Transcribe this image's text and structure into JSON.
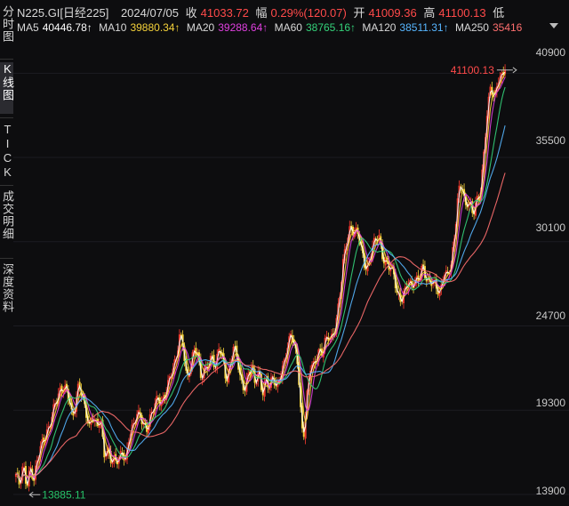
{
  "header": {
    "symbol": "N225.GI[日经225]",
    "date": "2024/07/05",
    "close_label": "收",
    "close_value": "41033.72",
    "change_label": "幅",
    "change_value": "0.29%(120.07)",
    "open_label": "开",
    "open_value": "41009.36",
    "high_label": "高",
    "high_value": "41100.13",
    "low_label": "低"
  },
  "ma_row": [
    {
      "label": "MA5",
      "value": "40446.78↑",
      "color": "#ffffff"
    },
    {
      "label": "MA10",
      "value": "39880.34↑",
      "color": "#f5d23a"
    },
    {
      "label": "MA20",
      "value": "39288.64↑",
      "color": "#e040e0"
    },
    {
      "label": "MA60",
      "value": "38765.16↑",
      "color": "#34d27a"
    },
    {
      "label": "MA120",
      "value": "38511.31↑",
      "color": "#57b6ff"
    },
    {
      "label": "MA250",
      "value": "35416",
      "color": "#ff6f6f"
    }
  ],
  "sidebar": {
    "tab_fenshi": "分时图",
    "tab_k": "K线图",
    "tab_tick": "TICK",
    "tab_deal": "成交明细",
    "tab_depth": "深度资料"
  },
  "colors": {
    "up": "#ff3b30",
    "down": "#f5d23a",
    "red_text": "#ff4a4a",
    "green_text": "#27c469",
    "background": "#0d0d0f"
  },
  "chart_data": {
    "type": "candlestick",
    "y_ticks": [
      "40900",
      "35500",
      "30100",
      "24700",
      "19300",
      "13900"
    ],
    "y_range": [
      13900,
      42400
    ],
    "max_label": "41100.13",
    "min_label": "13885.11",
    "close_path": [
      [
        0,
        15200
      ],
      [
        4,
        14400
      ],
      [
        8,
        15600
      ],
      [
        12,
        14500
      ],
      [
        16,
        15800
      ],
      [
        20,
        14900
      ],
      [
        24,
        16100
      ],
      [
        30,
        17200
      ],
      [
        36,
        18200
      ],
      [
        42,
        19500
      ],
      [
        48,
        20200
      ],
      [
        52,
        20600
      ],
      [
        56,
        20800
      ],
      [
        60,
        20000
      ],
      [
        63,
        18800
      ],
      [
        66,
        19600
      ],
      [
        70,
        20800
      ],
      [
        74,
        20100
      ],
      [
        78,
        19200
      ],
      [
        82,
        18400
      ],
      [
        86,
        19000
      ],
      [
        90,
        18000
      ],
      [
        94,
        18700
      ],
      [
        98,
        16500
      ],
      [
        102,
        16900
      ],
      [
        106,
        16200
      ],
      [
        110,
        16000
      ],
      [
        114,
        15900
      ],
      [
        118,
        16600
      ],
      [
        122,
        16200
      ],
      [
        126,
        17800
      ],
      [
        130,
        18200
      ],
      [
        134,
        18800
      ],
      [
        138,
        18900
      ],
      [
        142,
        18400
      ],
      [
        146,
        18300
      ],
      [
        150,
        19000
      ],
      [
        154,
        19500
      ],
      [
        158,
        19900
      ],
      [
        162,
        19700
      ],
      [
        166,
        20500
      ],
      [
        170,
        21300
      ],
      [
        174,
        21800
      ],
      [
        178,
        22300
      ],
      [
        182,
        24000
      ],
      [
        186,
        23600
      ],
      [
        190,
        21400
      ],
      [
        194,
        22000
      ],
      [
        198,
        23000
      ],
      [
        202,
        22800
      ],
      [
        206,
        21400
      ],
      [
        210,
        22100
      ],
      [
        214,
        22300
      ],
      [
        218,
        22600
      ],
      [
        222,
        21800
      ],
      [
        226,
        23400
      ],
      [
        230,
        22800
      ],
      [
        234,
        21300
      ],
      [
        238,
        22000
      ],
      [
        242,
        23200
      ],
      [
        246,
        22600
      ],
      [
        250,
        21300
      ],
      [
        254,
        20800
      ],
      [
        258,
        21500
      ],
      [
        262,
        22000
      ],
      [
        266,
        20800
      ],
      [
        270,
        21900
      ],
      [
        274,
        20500
      ],
      [
        278,
        21400
      ],
      [
        282,
        20700
      ],
      [
        286,
        21300
      ],
      [
        290,
        20600
      ],
      [
        294,
        21700
      ],
      [
        298,
        22400
      ],
      [
        302,
        23400
      ],
      [
        306,
        24000
      ],
      [
        310,
        23300
      ],
      [
        314,
        22000
      ],
      [
        318,
        18200
      ],
      [
        320,
        17800
      ],
      [
        324,
        20400
      ],
      [
        328,
        22100
      ],
      [
        332,
        22000
      ],
      [
        336,
        23200
      ],
      [
        340,
        23100
      ],
      [
        344,
        23800
      ],
      [
        348,
        23900
      ],
      [
        352,
        23700
      ],
      [
        356,
        24900
      ],
      [
        360,
        26700
      ],
      [
        364,
        29000
      ],
      [
        368,
        30100
      ],
      [
        372,
        30800
      ],
      [
        376,
        30600
      ],
      [
        380,
        30900
      ],
      [
        384,
        29900
      ],
      [
        388,
        28500
      ],
      [
        392,
        28300
      ],
      [
        396,
        29600
      ],
      [
        400,
        30300
      ],
      [
        404,
        30600
      ],
      [
        408,
        29100
      ],
      [
        412,
        28600
      ],
      [
        416,
        28300
      ],
      [
        420,
        28100
      ],
      [
        424,
        26900
      ],
      [
        428,
        26500
      ],
      [
        432,
        26800
      ],
      [
        436,
        27400
      ],
      [
        440,
        27100
      ],
      [
        444,
        27700
      ],
      [
        448,
        27900
      ],
      [
        452,
        28600
      ],
      [
        456,
        27600
      ],
      [
        460,
        27300
      ],
      [
        464,
        27600
      ],
      [
        468,
        27300
      ],
      [
        472,
        26900
      ],
      [
        476,
        28100
      ],
      [
        480,
        27700
      ],
      [
        484,
        28600
      ],
      [
        488,
        30600
      ],
      [
        492,
        33500
      ],
      [
        496,
        33800
      ],
      [
        500,
        32100
      ],
      [
        504,
        32600
      ],
      [
        508,
        31900
      ],
      [
        512,
        32900
      ],
      [
        516,
        33100
      ],
      [
        520,
        35300
      ],
      [
        524,
        38100
      ],
      [
        528,
        40100
      ],
      [
        532,
        39400
      ],
      [
        536,
        40600
      ],
      [
        540,
        40600
      ],
      [
        544,
        41100
      ]
    ],
    "series": [
      {
        "name": "MA5",
        "color": "#ffffff",
        "window": 2
      },
      {
        "name": "MA10",
        "color": "#f5d23a",
        "window": 4
      },
      {
        "name": "MA20",
        "color": "#e040e0",
        "window": 6
      },
      {
        "name": "MA60",
        "color": "#34d27a",
        "window": 12
      },
      {
        "name": "MA120",
        "color": "#57b6ff",
        "window": 20
      },
      {
        "name": "MA250",
        "color": "#ff6f6f",
        "window": 38
      }
    ]
  }
}
